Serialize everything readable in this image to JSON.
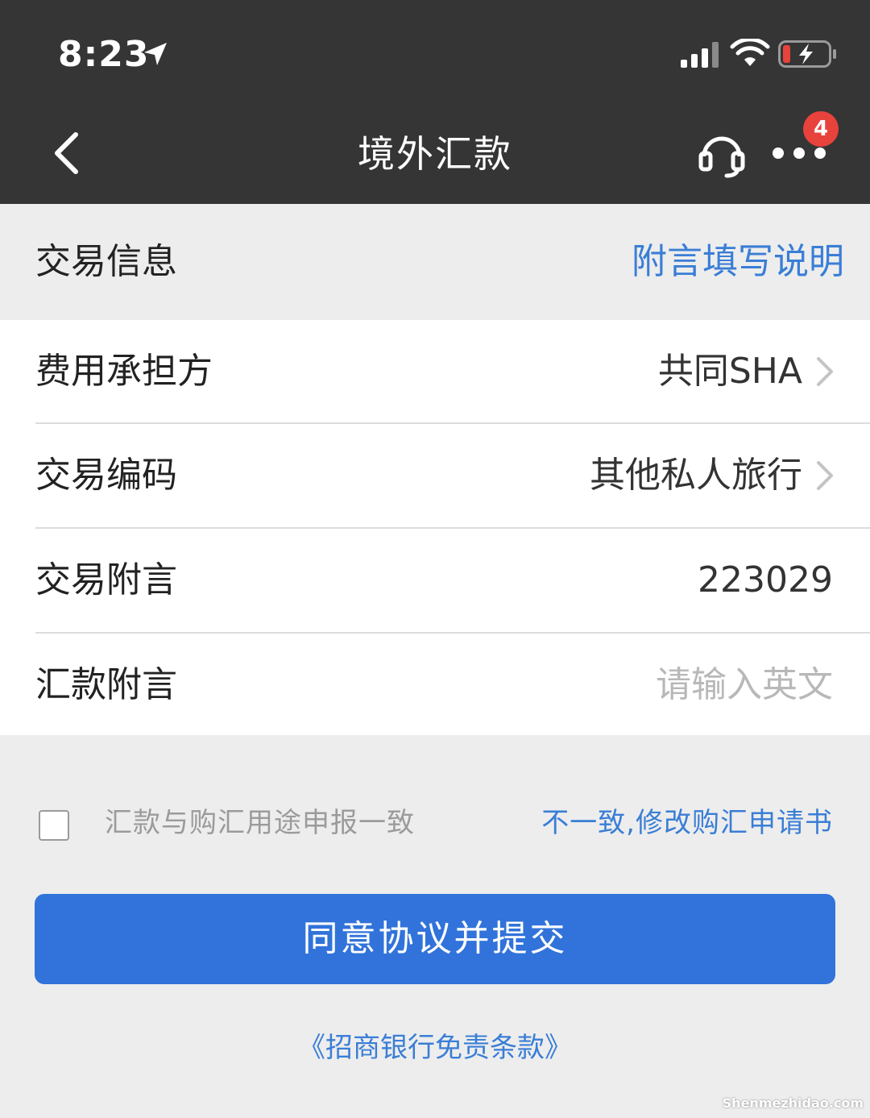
{
  "status_bar": {
    "time": "8:23"
  },
  "nav": {
    "title": "境外汇款",
    "badge_count": "4"
  },
  "section": {
    "title": "交易信息",
    "help_link": "附言填写说明"
  },
  "form": {
    "rows": [
      {
        "label": "费用承担方",
        "value": "共同SHA"
      },
      {
        "label": "交易编码",
        "value": "其他私人旅行"
      },
      {
        "label": "交易附言",
        "value": "223029"
      },
      {
        "label": "汇款附言",
        "placeholder": "请输入英文"
      }
    ]
  },
  "agreement": {
    "checkbox_label": "汇款与购汇用途申报一致",
    "modify_link": "不一致,修改购汇申请书"
  },
  "submit": {
    "label": "同意协议并提交"
  },
  "disclaimer": {
    "label": "《招商银行免责条款》"
  },
  "watermark": "Shenmezhidao.com",
  "colors": {
    "header_bg": "#353535",
    "link_blue": "#3a7ed6",
    "button_blue": "#3173da",
    "badge_red": "#e8423d",
    "page_bg": "#ededed"
  }
}
